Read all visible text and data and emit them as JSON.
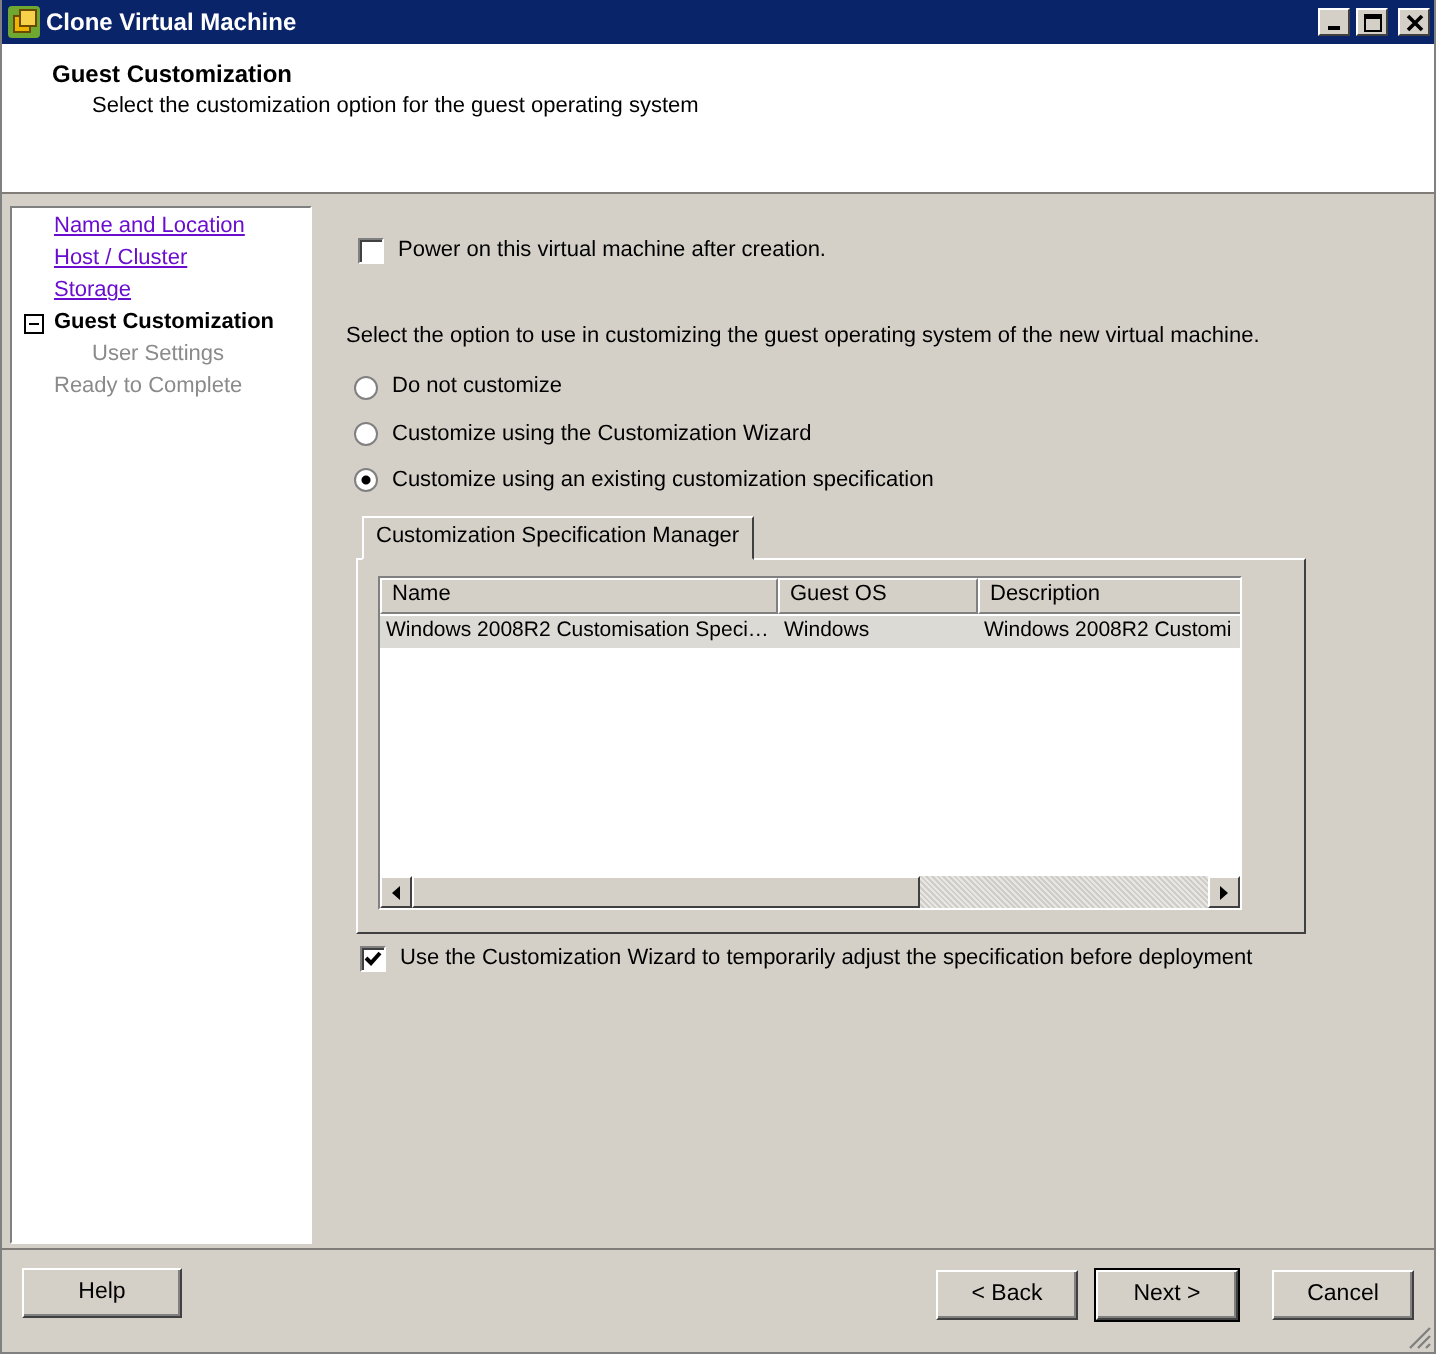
{
  "window": {
    "title": "Clone Virtual Machine"
  },
  "header": {
    "title": "Guest Customization",
    "subtitle": "Select the customization option for the guest operating system"
  },
  "steps": [
    {
      "label": "Name and Location",
      "visited": true,
      "current": false
    },
    {
      "label": "Host / Cluster",
      "visited": true,
      "current": false
    },
    {
      "label": "Storage",
      "visited": true,
      "current": false
    },
    {
      "label": "Guest Customization",
      "visited": false,
      "current": true,
      "expanded": true,
      "children": [
        {
          "label": "User Settings",
          "visited": false,
          "current": false
        }
      ]
    },
    {
      "label": "Ready to Complete",
      "visited": false,
      "current": false
    }
  ],
  "power_on": {
    "label": "Power on this virtual machine after creation.",
    "checked": false
  },
  "prompt": "Select the option to use in customizing the guest operating system of the new virtual machine.",
  "options": [
    {
      "label": "Do not customize",
      "selected": false
    },
    {
      "label": "Customize using the Customization Wizard",
      "selected": false
    },
    {
      "label": "Customize using an existing customization specification",
      "selected": true
    }
  ],
  "spec_tab": {
    "label": "Customization Specification Manager"
  },
  "table": {
    "columns": [
      "Name",
      "Guest OS",
      "Description"
    ],
    "rows": [
      {
        "cells": [
          "Windows 2008R2 Customisation Speci…",
          "Windows",
          "Windows 2008R2 Customi"
        ],
        "selected": true
      }
    ]
  },
  "adjust": {
    "label": "Use the Customization Wizard to temporarily adjust the specification before deployment",
    "checked": true
  },
  "buttons": [
    {
      "label": "Help",
      "default": false
    },
    {
      "label": "< Back",
      "default": false
    },
    {
      "label": "Next >",
      "default": true
    },
    {
      "label": "Cancel",
      "default": false
    }
  ]
}
